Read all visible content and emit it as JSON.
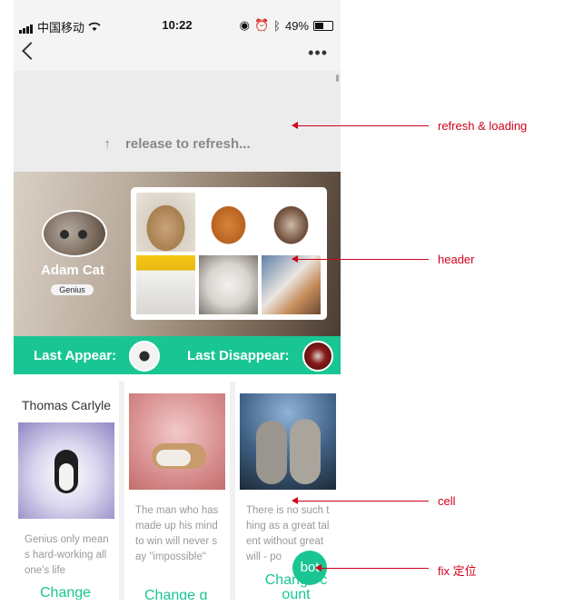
{
  "status_bar": {
    "carrier": "中国移动",
    "time": "10:22",
    "battery": "49%"
  },
  "navbar": {
    "back_icon": "chevron-left-icon",
    "more_icon": "ellipsis-icon",
    "more_glyph": "•••"
  },
  "refresh": {
    "arrow_glyph": "↑",
    "text": "release to refresh..."
  },
  "header": {
    "user_name": "Adam Cat",
    "badge": "Genius",
    "grid_photo_count": 6
  },
  "appear_bar": {
    "last_appear": "Last Appear:",
    "last_disappear": "Last Disappear:"
  },
  "cards": [
    {
      "title": "Thomas Carlyle",
      "body": "Genius only means hard-working all one's life",
      "more": "Change"
    },
    {
      "title": "",
      "body": "The man who has made up his mind to win will never say \"impossible\"",
      "more": "Change g"
    },
    {
      "title": "",
      "body": "There is no such thing as a great talent without great will - po",
      "more": "Change c ount"
    }
  ],
  "fab": {
    "label": "bot"
  },
  "annotations": [
    {
      "label": "refresh & loading"
    },
    {
      "label": "header"
    },
    {
      "label": "cell"
    },
    {
      "label": "fix 定位"
    }
  ],
  "colors": {
    "accent": "#19c693",
    "annotation": "#d0021b"
  }
}
